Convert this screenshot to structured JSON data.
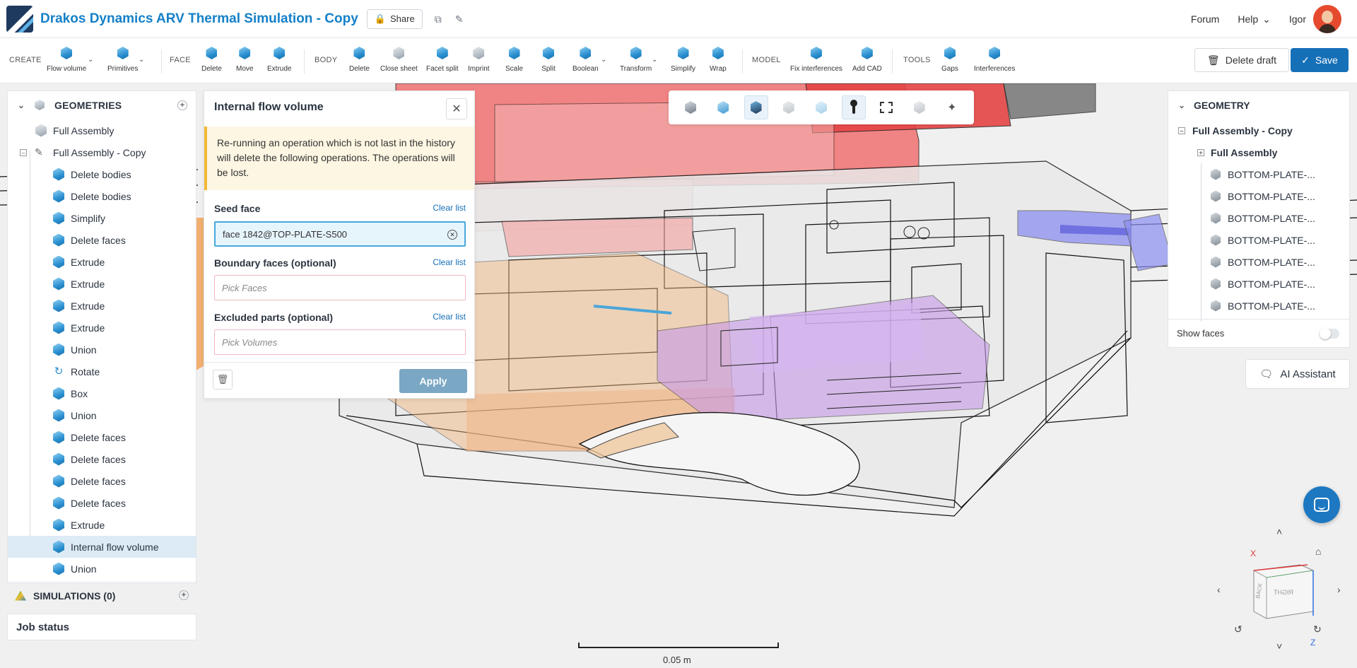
{
  "header": {
    "title": "Drakos Dynamics ARV Thermal Simulation - Copy",
    "share_label": "Share",
    "forum": "Forum",
    "help": "Help",
    "user": "Igor"
  },
  "toolbar": {
    "sections": {
      "create": "CREATE",
      "face": "FACE",
      "body": "BODY",
      "model": "MODEL",
      "tools": "TOOLS"
    },
    "create": [
      "Flow volume",
      "Primitives"
    ],
    "face": [
      "Delete",
      "Move",
      "Extrude"
    ],
    "body": [
      "Delete",
      "Close sheet",
      "Facet split",
      "Imprint",
      "Scale",
      "Split",
      "Boolean",
      "Transform",
      "Simplify",
      "Wrap"
    ],
    "model": [
      "Fix interferences",
      "Add CAD"
    ],
    "tools": [
      "Gaps",
      "Interferences"
    ],
    "delete_draft": "Delete draft",
    "save": "Save"
  },
  "left_panel": {
    "geometries_title": "GEOMETRIES",
    "full_assembly": "Full Assembly",
    "full_assembly_copy": "Full Assembly - Copy",
    "operations": [
      "Delete bodies",
      "Delete bodies",
      "Simplify",
      "Delete faces",
      "Extrude",
      "Extrude",
      "Extrude",
      "Extrude",
      "Union",
      "Rotate",
      "Box",
      "Union",
      "Delete faces",
      "Delete faces",
      "Delete faces",
      "Delete faces",
      "Extrude",
      "Internal flow volume",
      "Union"
    ],
    "selected_operation": "Internal flow volume",
    "simulations": "SIMULATIONS (0)",
    "job_status": "Job status"
  },
  "dialog": {
    "title": "Internal flow volume",
    "warning": "Re-running an operation which is not last in the history will delete the following operations. The operations will be lost.",
    "seed_face_label": "Seed face",
    "seed_face_value": "face 1842@TOP-PLATE-S500",
    "boundary_label": "Boundary faces (optional)",
    "boundary_placeholder": "Pick Faces",
    "excluded_label": "Excluded parts (optional)",
    "excluded_placeholder": "Pick Volumes",
    "clear_list": "Clear list",
    "apply": "Apply"
  },
  "right_panel": {
    "title": "GEOMETRY",
    "root": "Full Assembly - Copy",
    "child": "Full Assembly",
    "parts": [
      "BOTTOM-PLATE-...",
      "BOTTOM-PLATE-...",
      "BOTTOM-PLATE-...",
      "BOTTOM-PLATE-...",
      "BOTTOM-PLATE-...",
      "BOTTOM-PLATE-...",
      "BOTTOM-PLATE-..."
    ],
    "show_faces": "Show faces"
  },
  "ai_assistant": "AI Assistant",
  "scale_label": "0.05 m",
  "nav_cube": {
    "x_axis": "X",
    "z_axis": "Z",
    "face_left": "BACK",
    "face_right": "RIGHT"
  },
  "colors": {
    "accent": "#1670b8",
    "title": "#1580c8",
    "warning_bg": "#fdf6e3",
    "warning_border": "#f2b935",
    "selection": "#dcebf6"
  }
}
